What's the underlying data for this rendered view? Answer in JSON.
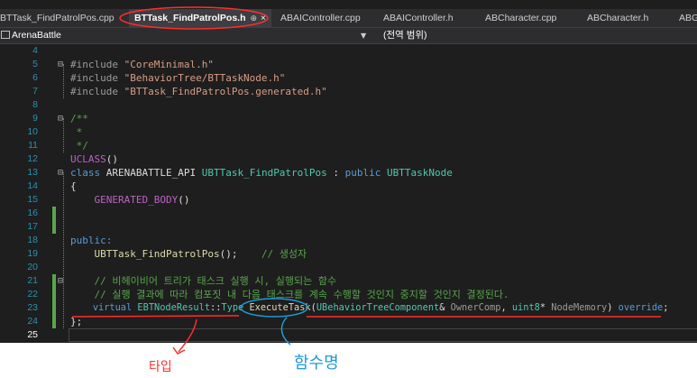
{
  "tabs": [
    {
      "label": "BTTask_FindPatrolPos.cpp",
      "active": false
    },
    {
      "label": "BTTask_FindPatrolPos.h",
      "active": true,
      "pin": "⊕",
      "close": "×"
    },
    {
      "label": "ABAIController.cpp",
      "active": false
    },
    {
      "label": "ABAIController.h",
      "active": false
    },
    {
      "label": "ABCharacter.cpp",
      "active": false
    },
    {
      "label": "ABCharacter.h",
      "active": false
    },
    {
      "label": "ABG",
      "active": false
    }
  ],
  "navbar": {
    "project": "ArenaBattle",
    "scope": "(전역 범위)"
  },
  "lines": [
    {
      "n": "4",
      "text": ""
    },
    {
      "n": "5",
      "text": "#include \"CoreMinimal.h\""
    },
    {
      "n": "6",
      "text": "#include \"BehaviorTree/BTTaskNode.h\""
    },
    {
      "n": "7",
      "text": "#include \"BTTask_FindPatrolPos.generated.h\""
    },
    {
      "n": "8",
      "text": ""
    },
    {
      "n": "9",
      "text": "/**"
    },
    {
      "n": "10",
      "text": " *"
    },
    {
      "n": "11",
      "text": " */"
    },
    {
      "n": "12",
      "text": "UCLASS()"
    },
    {
      "n": "13",
      "text": "class ARENABATTLE_API UBTTask_FindPatrolPos : public UBTTaskNode"
    },
    {
      "n": "14",
      "text": "{"
    },
    {
      "n": "15",
      "text": "    GENERATED_BODY()"
    },
    {
      "n": "16",
      "text": ""
    },
    {
      "n": "17",
      "text": ""
    },
    {
      "n": "18",
      "text": "public:"
    },
    {
      "n": "19",
      "text": "    UBTTask_FindPatrolPos();    // 생성자"
    },
    {
      "n": "20",
      "text": ""
    },
    {
      "n": "21",
      "text": "    // 비헤이비어 트리가 태스크 실행 시, 실행되는 함수"
    },
    {
      "n": "22",
      "text": "    // 실행 결과에 따라 컴포짓 내 다음 태스크를 계속 수행할 것인지 중지할 것인지 결정된다."
    },
    {
      "n": "23",
      "text": "    virtual EBTNodeResult::Type ExecuteTask(UBehaviorTreeComponent& OwnerComp, uint8* NodeMemory) override;"
    },
    {
      "n": "24",
      "text": "};"
    },
    {
      "n": "25",
      "text": ""
    }
  ],
  "annotations": {
    "type_label": "타입",
    "function_name_label": "함수명"
  },
  "colors": {
    "editor_bg": "#1e1e1e",
    "keyword": "#569cd6",
    "string": "#d69d85",
    "type": "#4ec9b0",
    "comment": "#57a64a",
    "macro": "#bd63c5",
    "function": "#dcdcaa",
    "annotation_red": "#ff2d2d",
    "annotation_blue": "#1e9bd7"
  }
}
